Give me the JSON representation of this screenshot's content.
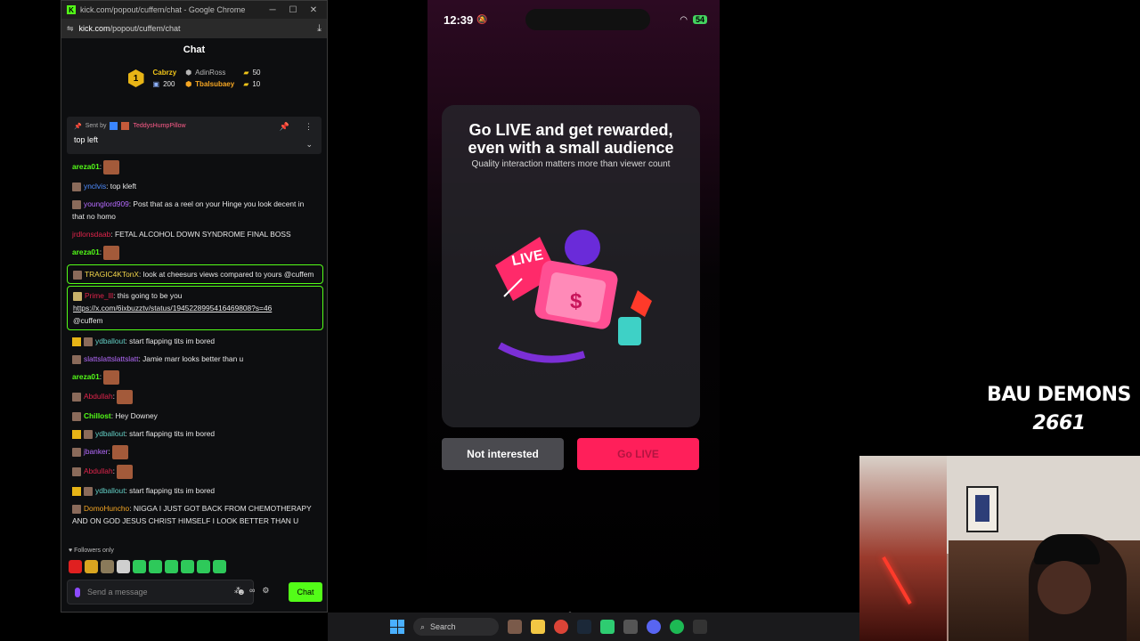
{
  "chat_window": {
    "title": "kick.com/popout/cuffem/chat - Google Chrome",
    "url_host": "kick.com",
    "url_path": "/popout/cuffem/chat",
    "header": "Chat",
    "leaderboard": {
      "rank": "1",
      "first_name": "Cabrzy",
      "first_amount": "200",
      "second_name": "AdinRoss",
      "second_amount": "50",
      "third_name": "Tbalsubaey",
      "third_amount": "10"
    },
    "pinned": {
      "sent_by_label": "Sent by",
      "sender": "TeddysHumpPillow",
      "text": "top left"
    },
    "messages": [
      {
        "user": "areza01",
        "text": ""
      },
      {
        "user": "ynclvis",
        "text": ": top kleft"
      },
      {
        "user": "younglord909",
        "text": ": Post that as a reel on your Hinge you look decent in that no homo"
      },
      {
        "user": "jrdlonsdaab",
        "text": ": FETAL ALCOHOL DOWN SYNDROME FINAL BOSS"
      },
      {
        "user": "areza01",
        "text": ""
      },
      {
        "user": "TRAGIC4KTonX",
        "text": ": look at cheesurs views compared to yours @cuffem"
      },
      {
        "user": "Prime_lll",
        "text": ": this going to be you",
        "link": "https://x.com/6ixbuzztv/status/1945228995416469808?s=46",
        "after": "@cuffem"
      },
      {
        "user": "ydballout",
        "text": ": start flapping tits im bored"
      },
      {
        "user": "slattslattslattslatt",
        "text": ": Jamie marr looks better than u"
      },
      {
        "user": "areza01",
        "text": ""
      },
      {
        "user": "Abdullah",
        "text": ""
      },
      {
        "user": "Chillost",
        "text": ": Hey Downey"
      },
      {
        "user": "ydballout",
        "text": ": start flapping tits im bored"
      },
      {
        "user": "jbanker",
        "text": ""
      },
      {
        "user": "Abdullah",
        "text": ""
      },
      {
        "user": "ydballout",
        "text": ": start flapping tits im bored"
      },
      {
        "user": "DomoHuncho",
        "text": ": NIGGA I JUST GOT BACK FROM CHEMOTHERAPY AND ON GOD JESUS CHRIST HIMSELF I LOOK BETTER THAN U"
      }
    ],
    "followers_only": "Followers only",
    "input_placeholder": "Send a message",
    "chat_button": "Chat",
    "viewers_icon_label": "∞"
  },
  "phone": {
    "time": "12:39",
    "battery": "54",
    "headline_line1": "Go LIVE and get rewarded,",
    "headline_line2": "even with a small audience",
    "subtext": "Quality interaction matters more than viewer count",
    "live_badge": "LIVE",
    "not_interested": "Not interested",
    "go_live": "Go LIVE"
  },
  "overlay": {
    "line1": "BAU DEMONS",
    "line2": "2661"
  },
  "taskbar": {
    "search_label": "Search"
  },
  "colors": {
    "kick_green": "#53fc18",
    "go_live_pink": "#ff1f5a"
  }
}
